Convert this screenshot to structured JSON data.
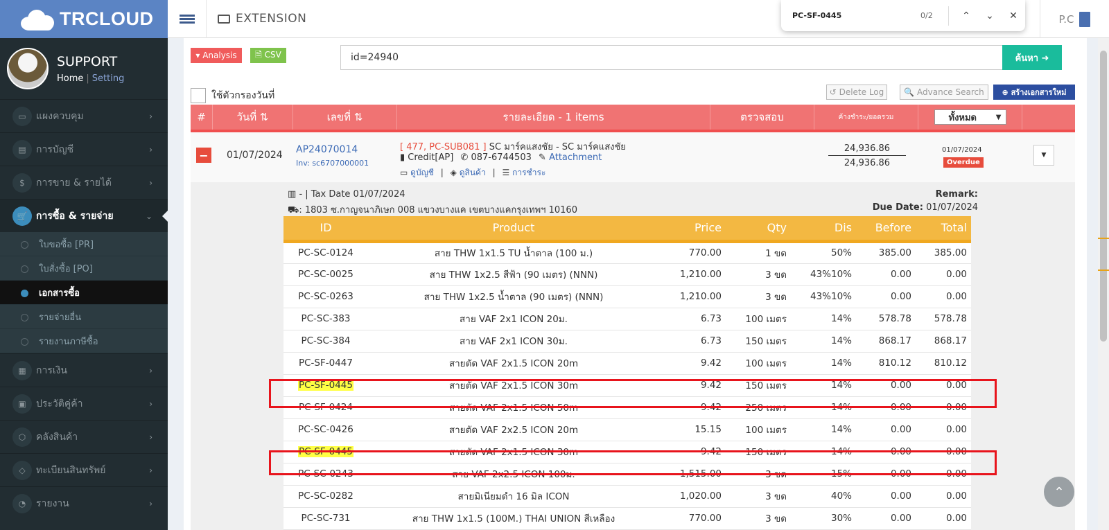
{
  "app": {
    "brand": "TRCLOUD"
  },
  "user": {
    "name": "SUPPORT",
    "home": "Home",
    "sep": "|",
    "setting": "Setting"
  },
  "sidebar": {
    "items": [
      {
        "label": "แผงควบคุม",
        "icon": "monitor-icon"
      },
      {
        "label": "การบัญชี",
        "icon": "book-icon"
      },
      {
        "label": "การขาย & รายได้",
        "icon": "dollar-icon"
      },
      {
        "label": "การซื้อ & รายจ่าย",
        "icon": "cart-icon"
      }
    ],
    "subitems": [
      {
        "label": "ใบขอซื้อ [PR]"
      },
      {
        "label": "ใบสั่งซื้อ [PO]"
      },
      {
        "label": "เอกสารซื้อ"
      },
      {
        "label": "รายจ่ายอื่น"
      },
      {
        "label": "รายงานภาษีซื้อ"
      }
    ],
    "items2": [
      {
        "label": "การเงิน",
        "icon": "calendar-icon"
      },
      {
        "label": "ประวัติคู่ค้า",
        "icon": "contact-icon"
      },
      {
        "label": "คลังสินค้า",
        "icon": "boxes-icon"
      },
      {
        "label": "ทะเบียนสินทรัพย์",
        "icon": "diamond-icon"
      },
      {
        "label": "รายงาน",
        "icon": "report-icon"
      }
    ]
  },
  "topbar": {
    "extension": "EXTENSION",
    "company": "P.C"
  },
  "find": {
    "query": "PC-SF-0445",
    "count": "0/2",
    "up": "⌃",
    "down": "⌄",
    "close": "✕"
  },
  "toolbar": {
    "analysis": "▾ Analysis",
    "csv": "🗎 CSV",
    "search_value": "id=24940",
    "search_btn": "ค้นหา ➜",
    "date_filter": "ใช้ตัวกรองวันที่",
    "delete_log": "↺ Delete Log",
    "advance_search": "🔍 Advance Search",
    "new_doc": "⊕ สร้างเอกสารใหม่"
  },
  "table_head": {
    "hash": "#",
    "date": "วันที่ ⇅",
    "number": "เลขที่ ⇅",
    "detail": "รายละเอียด - 1 items",
    "check": "ตรวจสอบ",
    "balance": "ค้างชำระ/ยอดรวม",
    "filter": "ทั้งหมด"
  },
  "doc": {
    "date": "01/07/2024",
    "number": "AP24070014",
    "inv": "Inv: sc6707000001",
    "sub_code": "[ 477, PC-SUB081 ]",
    "sub_name": "SC มาร์คแสงชัย - SC มาร์คแสงชัย",
    "credit": "Credit[AP]",
    "phone": "087-6744503",
    "attachment": "Attachment",
    "link_account": "ดูบัญชี",
    "link_product": "ดูสินค้า",
    "link_payment": "การชำระ",
    "amount1": "24,936.86",
    "amount2": "24,936.86",
    "due": "01/07/2024",
    "status": "Overdue"
  },
  "detail": {
    "tax_line": "- | Tax Date 01/07/2024",
    "address": ": 1803 ซ.กาญจนาภิเษก 008 แขวงบางแค เขตบางแคกรุงเทพฯ 10160",
    "remark": "Remark:",
    "due_label": "Due Date:",
    "due_value": "01/07/2024"
  },
  "items": {
    "headers": [
      "ID",
      "Product",
      "Price",
      "Qty",
      "Dis",
      "Before",
      "Total"
    ],
    "rows": [
      [
        "PC-SC-0124",
        "สาย THW 1x1.5 TU น้ำตาล (100 ม.)",
        "770.00",
        "1 ขด",
        "50%",
        "385.00",
        "385.00"
      ],
      [
        "PC-SC-0025",
        "สาย THW 1x2.5 สีฟ้า (90 เมตร) (NNN)",
        "1,210.00",
        "3 ขด",
        "43%10%",
        "0.00",
        "0.00"
      ],
      [
        "PC-SC-0263",
        "สาย THW 1x2.5 น้ำตาล (90 เมตร) (NNN)",
        "1,210.00",
        "3 ขด",
        "43%10%",
        "0.00",
        "0.00"
      ],
      [
        "PC-SC-383",
        "สาย VAF 2x1 ICON 20ม.",
        "6.73",
        "100 เมตร",
        "14%",
        "578.78",
        "578.78"
      ],
      [
        "PC-SC-384",
        "สาย VAF 2x1 ICON 30ม.",
        "6.73",
        "150 เมตร",
        "14%",
        "868.17",
        "868.17"
      ],
      [
        "PC-SF-0447",
        "สายตัด VAF 2x1.5 ICON 20m",
        "9.42",
        "100 เมตร",
        "14%",
        "810.12",
        "810.12"
      ],
      [
        "PC-SF-0445",
        "สายตัด VAF 2x1.5 ICON 30m",
        "9.42",
        "150 เมตร",
        "14%",
        "0.00",
        "0.00"
      ],
      [
        "PC-SF-0424",
        "สายตัด VAF 2x1.5 ICON 50m",
        "9.42",
        "250 เมตร",
        "14%",
        "0.00",
        "0.00"
      ],
      [
        "PC-SC-0426",
        "สายตัด VAF 2x2.5 ICON 20m",
        "15.15",
        "100 เมตร",
        "14%",
        "0.00",
        "0.00"
      ],
      [
        "PC-SF-0445",
        "สายตัด VAF 2x1.5 ICON 30m",
        "9.42",
        "150 เมตร",
        "14%",
        "0.00",
        "0.00"
      ],
      [
        "PC-SC-0243",
        "สาย VAF 2x2.5 ICON 100ม.",
        "1,515.00",
        "3 ขด",
        "15%",
        "0.00",
        "0.00"
      ],
      [
        "PC-SC-0282",
        "สายมิเนียมดำ 16 มิล ICON",
        "1,020.00",
        "3 ขด",
        "40%",
        "0.00",
        "0.00"
      ],
      [
        "PC-SC-731",
        "สาย THW 1x1.5 (100M.) THAI UNION สีเหลือง",
        "770.00",
        "3 ขด",
        "30%",
        "0.00",
        "0.00"
      ]
    ],
    "highlight_rows": [
      6,
      9
    ]
  },
  "scroll_top": "⌃"
}
